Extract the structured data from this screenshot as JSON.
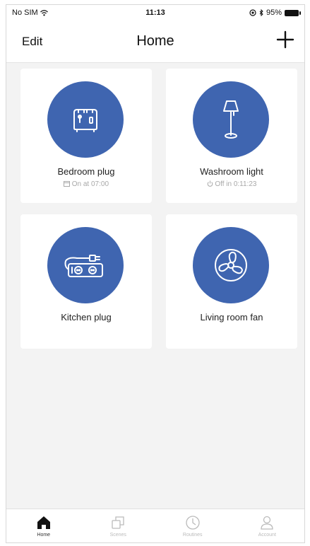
{
  "status_bar": {
    "carrier": "No SIM",
    "time": "11:13",
    "battery": "95%"
  },
  "nav": {
    "edit_label": "Edit",
    "title": "Home"
  },
  "devices": [
    {
      "name": "Bedroom plug",
      "status": "On at 07:00",
      "icon": "toaster-icon"
    },
    {
      "name": "Washroom light",
      "status": "Off in 0:11:23",
      "icon": "floor-lamp-icon"
    },
    {
      "name": "Kitchen plug",
      "status": "",
      "icon": "power-strip-icon"
    },
    {
      "name": "Living room fan",
      "status": "",
      "icon": "fan-icon"
    }
  ],
  "tabs": [
    {
      "label": "Home",
      "icon": "home-icon",
      "active": true
    },
    {
      "label": "Scenes",
      "icon": "scenes-icon",
      "active": false
    },
    {
      "label": "Routines",
      "icon": "clock-icon",
      "active": false
    },
    {
      "label": "Account",
      "icon": "account-icon",
      "active": false
    }
  ],
  "colors": {
    "accent": "#3f65b0",
    "background": "#f3f3f3"
  }
}
